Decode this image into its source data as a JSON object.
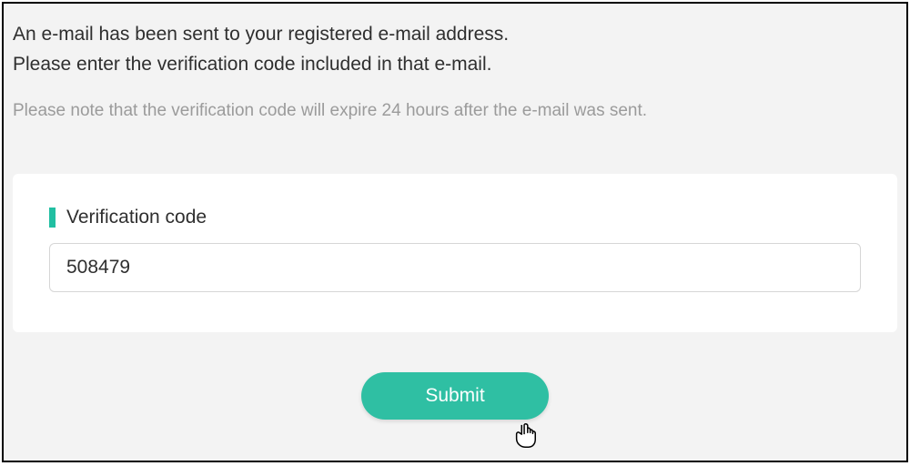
{
  "message": {
    "line1": "An e-mail has been sent to your registered e-mail address.",
    "line2": "Please enter the verification code included in that e-mail."
  },
  "note": "Please note that the verification code will expire 24 hours after the e-mail was sent.",
  "form": {
    "field_label": "Verification code",
    "code_value": "508479",
    "submit_label": "Submit"
  },
  "colors": {
    "accent": "#2fbfa3"
  }
}
